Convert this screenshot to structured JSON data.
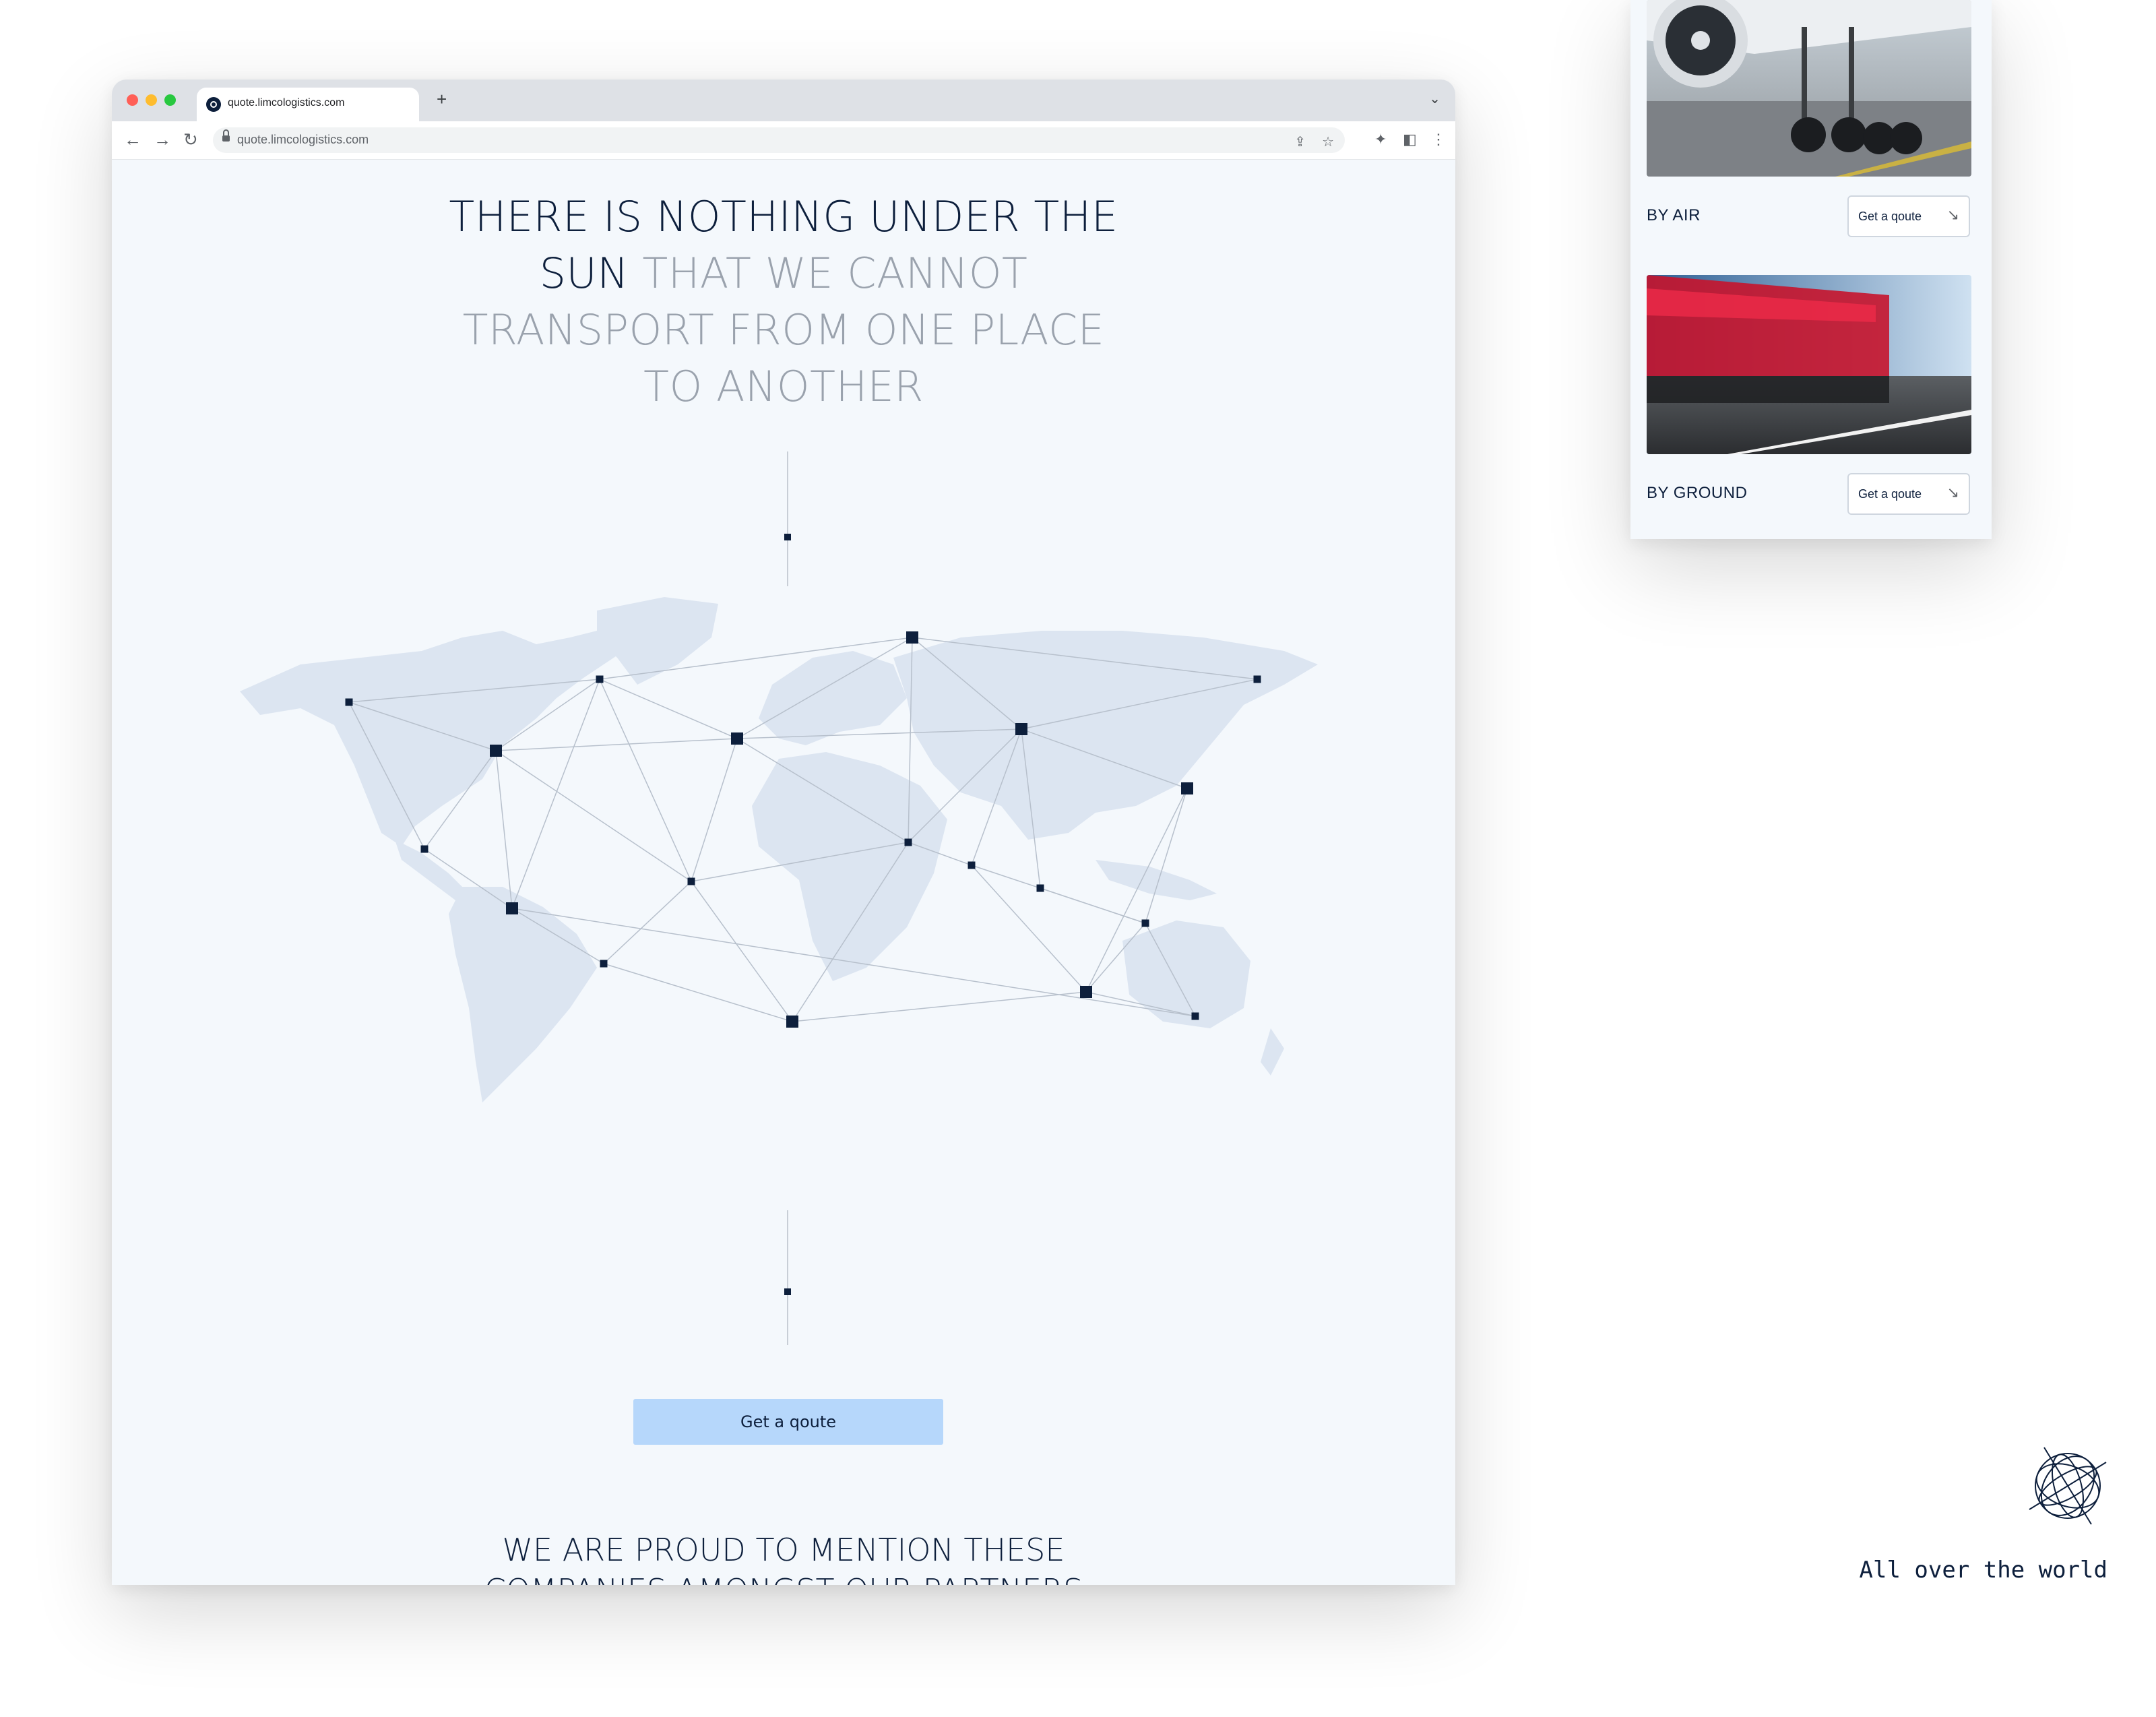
{
  "browser": {
    "tab_title": "quote.limcologistics.com",
    "new_tab": "+",
    "tab_menu": "⌄",
    "url": "quote.limcologistics.com",
    "nav": {
      "back": "←",
      "forward": "→",
      "reload": "↻"
    },
    "icons": {
      "share": "⇪",
      "bookmark": "☆",
      "extensions": "✦",
      "sidepanel": "◧",
      "menu": "⋮"
    }
  },
  "hero": {
    "headline_dark": "THERE IS NOTHING UNDER THE SUN",
    "headline_light": "THAT WE CANNOT TRANSPORT FROM ONE PLACE TO ANOTHER"
  },
  "cta": {
    "label": "Get a qoute"
  },
  "partners": {
    "heading": "WE ARE PROUD TO MENTION THESE COMPANIES AMONGST OUR PARTNERS"
  },
  "side_panel": {
    "cards": [
      {
        "label": "BY AIR",
        "button": "Get a qoute",
        "image": "airplane-landing-gear"
      },
      {
        "label": "BY GROUND",
        "button": "Get a qoute",
        "image": "truck-in-motion"
      }
    ]
  },
  "footer_mark": {
    "tagline": "All over the world",
    "icon": "globe-icon"
  },
  "colors": {
    "navy": "#0d1f3c",
    "muted": "#9aa2ad",
    "cta_bg": "#b6d7fb",
    "page_bg": "#f4f8fc",
    "map_land": "#dce5f1"
  }
}
